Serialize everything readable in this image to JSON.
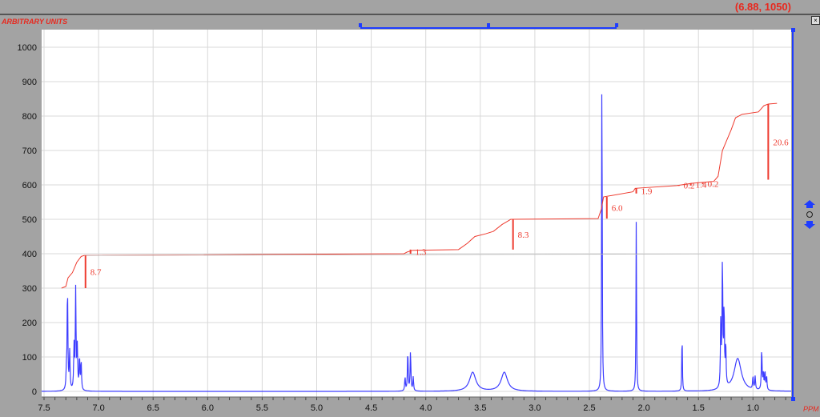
{
  "cursor_readout": "(6.88, 1050)",
  "y_units": "ARBITRARY UNITS",
  "x_units": "PPM",
  "colors": {
    "spectrum": "#3d3dff",
    "integral": "#ee3b2f",
    "axis": "#e8281e"
  },
  "chart_data": {
    "type": "line",
    "title": "",
    "xlabel": "PPM",
    "ylabel": "ARBITRARY UNITS",
    "xlim": [
      7.52,
      0.65
    ],
    "ylim": [
      -10,
      1050
    ],
    "x_ticks": [
      "7.5",
      "7.0",
      "6.5",
      "6.0",
      "5.5",
      "5.0",
      "4.5",
      "4.0",
      "3.5",
      "3.0",
      "2.5",
      "2.0",
      "1.5",
      "1.0"
    ],
    "y_ticks": [
      "0",
      "100",
      "200",
      "300",
      "400",
      "500",
      "600",
      "700",
      "800",
      "900",
      "1000"
    ],
    "grid": true,
    "peaks": [
      [
        7.285,
        300,
        0.004
      ],
      [
        7.265,
        110,
        0.004
      ],
      [
        7.295,
        50,
        0.004
      ],
      [
        7.21,
        290,
        0.004
      ],
      [
        7.225,
        125,
        0.004
      ],
      [
        7.195,
        120,
        0.004
      ],
      [
        7.175,
        95,
        0.004
      ],
      [
        7.16,
        85,
        0.004
      ],
      [
        4.165,
        115,
        0.004
      ],
      [
        4.14,
        115,
        0.004
      ],
      [
        4.19,
        40,
        0.004
      ],
      [
        4.115,
        40,
        0.004
      ],
      [
        3.57,
        55,
        0.035
      ],
      [
        3.28,
        55,
        0.035
      ],
      [
        2.385,
        1000,
        0.003
      ],
      [
        2.07,
        505,
        0.003
      ],
      [
        1.65,
        175,
        0.003
      ],
      [
        1.295,
        195,
        0.004
      ],
      [
        1.28,
        370,
        0.004
      ],
      [
        1.265,
        225,
        0.004
      ],
      [
        1.25,
        120,
        0.004
      ],
      [
        1.14,
        95,
        0.04
      ],
      [
        1.0,
        38,
        0.004
      ],
      [
        0.98,
        38,
        0.004
      ],
      [
        0.92,
        120,
        0.004
      ],
      [
        0.905,
        50,
        0.004
      ],
      [
        0.89,
        55,
        0.004
      ],
      [
        0.875,
        40,
        0.004
      ]
    ],
    "integral_curve": [
      [
        7.34,
        300
      ],
      [
        7.3,
        305
      ],
      [
        7.28,
        330
      ],
      [
        7.24,
        345
      ],
      [
        7.2,
        375
      ],
      [
        7.16,
        392
      ],
      [
        7.13,
        395
      ],
      [
        4.2,
        400
      ],
      [
        4.17,
        405
      ],
      [
        4.12,
        410
      ],
      [
        3.7,
        412
      ],
      [
        3.62,
        430
      ],
      [
        3.55,
        450
      ],
      [
        3.45,
        458
      ],
      [
        3.38,
        465
      ],
      [
        3.3,
        485
      ],
      [
        3.22,
        500
      ],
      [
        2.42,
        502
      ],
      [
        2.39,
        530
      ],
      [
        2.37,
        565
      ],
      [
        2.1,
        580
      ],
      [
        2.08,
        590
      ],
      [
        1.7,
        598
      ],
      [
        1.55,
        605
      ],
      [
        1.36,
        610
      ],
      [
        1.32,
        625
      ],
      [
        1.28,
        700
      ],
      [
        1.24,
        730
      ],
      [
        1.2,
        760
      ],
      [
        1.16,
        795
      ],
      [
        1.1,
        805
      ],
      [
        0.95,
        812
      ],
      [
        0.9,
        830
      ],
      [
        0.86,
        835
      ],
      [
        0.78,
        837
      ]
    ],
    "integrals": [
      {
        "label": "8.7",
        "ppm": 7.12,
        "from": 300,
        "to": 395
      },
      {
        "label": "1.3",
        "ppm": 4.14,
        "from": 400,
        "to": 412
      },
      {
        "label": "8.3",
        "ppm": 3.2,
        "from": 412,
        "to": 500
      },
      {
        "label": "6.0",
        "ppm": 2.34,
        "from": 502,
        "to": 565
      },
      {
        "label": "1.9",
        "ppm": 2.07,
        "from": 575,
        "to": 590
      },
      {
        "label": "0.2",
        "ppm": 1.68,
        "from": 597,
        "to": 600
      },
      {
        "label": "1.4",
        "ppm": 1.57,
        "from": 598,
        "to": 605
      },
      {
        "label": "0.2",
        "ppm": 1.46,
        "from": 602,
        "to": 606
      },
      {
        "label": "20.6",
        "ppm": 0.86,
        "from": 615,
        "to": 835
      }
    ],
    "range_selector": {
      "from": 4.6,
      "to": 2.25
    }
  }
}
